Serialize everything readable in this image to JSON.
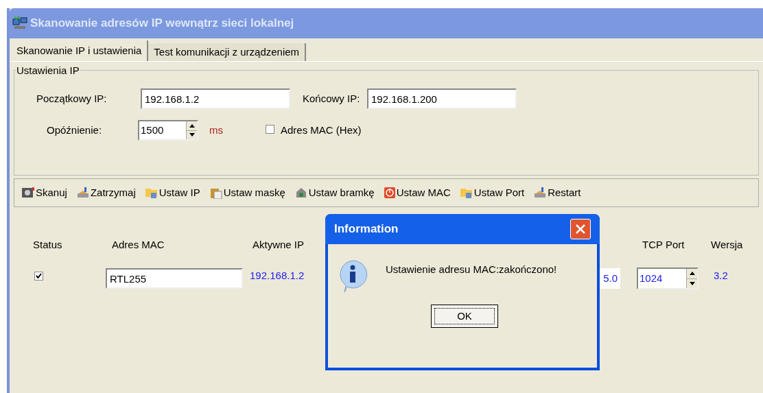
{
  "window": {
    "title": "Skanowanie adresów IP wewnątrz sieci lokalnej"
  },
  "tabs": [
    {
      "label": "Skanowanie IP i ustawienia",
      "selected": true
    },
    {
      "label": "Test komunikacji z urządzeniem",
      "selected": false
    }
  ],
  "ip_settings": {
    "legend": "Ustawienia IP",
    "start_ip": {
      "label": "Początkowy IP:",
      "value": "192.168.1.2"
    },
    "end_ip": {
      "label": "Końcowy IP:",
      "value": "192.168.1.200"
    },
    "delay": {
      "label": "Opóźnienie:",
      "value": "1500",
      "unit": "ms"
    },
    "mac_hex": {
      "label": "Adres MAC (Hex)",
      "checked": false
    }
  },
  "toolbar": [
    {
      "label": "Skanuj"
    },
    {
      "label": "Zatrzymaj"
    },
    {
      "label": "Ustaw IP"
    },
    {
      "label": "Ustaw maskę"
    },
    {
      "label": "Ustaw bramkę"
    },
    {
      "label": "Ustaw MAC"
    },
    {
      "label": "Ustaw Port"
    },
    {
      "label": "Restart"
    }
  ],
  "table": {
    "columns": [
      "Status",
      "Adres MAC",
      "Aktywne IP",
      "TCP Port",
      "Wersja"
    ],
    "rows": [
      {
        "checked": true,
        "mac": "RTL255",
        "ip": "192.168.1.2",
        "column_4": "5.0",
        "tcp_port": "1024",
        "version": "3.2"
      }
    ]
  },
  "dialog": {
    "title": "Information",
    "message": "Ustawienie adresu MAC:zakończono!",
    "button": "OK"
  }
}
